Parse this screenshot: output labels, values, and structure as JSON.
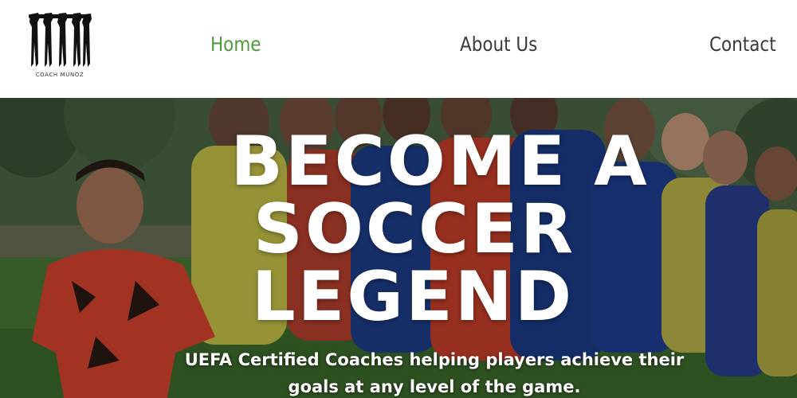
{
  "brand": {
    "logo_caption": "COACH MUNOZ"
  },
  "nav": {
    "items": [
      {
        "label": "Home",
        "active": true
      },
      {
        "label": "About Us",
        "active": false
      },
      {
        "label": "Contact",
        "active": false
      }
    ]
  },
  "hero": {
    "headline_line1": "BECOME A",
    "headline_line2": "SOCCER",
    "headline_line3": "LEGEND",
    "subtitle": "UEFA Certified Coaches helping players achieve their goals at any level of the game."
  },
  "colors": {
    "active_nav": "#4f9a3c",
    "nav_text": "#3a3a3a",
    "headline": "#ffffff"
  }
}
